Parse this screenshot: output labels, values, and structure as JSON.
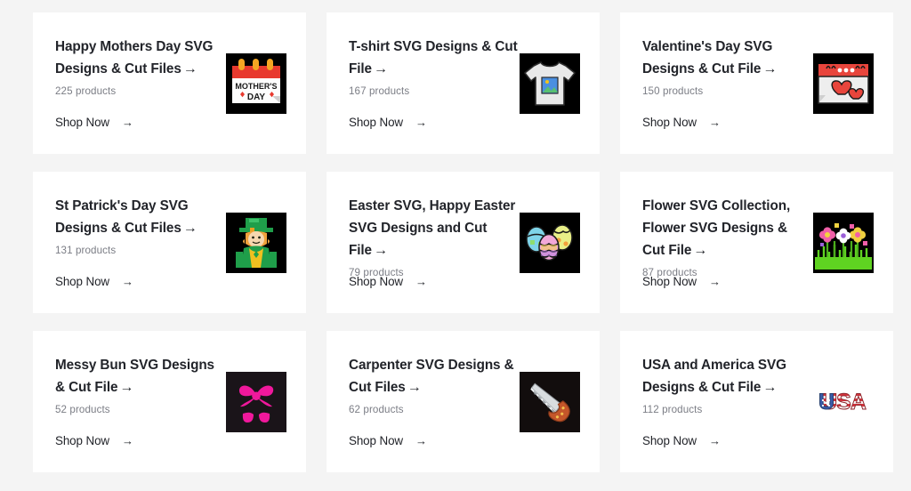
{
  "page": {
    "background_color": "#f4f4f4",
    "card_background_color": "#ffffff",
    "title_color": "#22242a",
    "count_color": "#7b7d85"
  },
  "common": {
    "shop_now_label": "Shop Now",
    "title_arrow": "→",
    "shop_arrow": "→"
  },
  "cards": [
    {
      "title": "Happy Mothers Day SVG Designs & Cut Files",
      "count": "225 products",
      "shop_now": "Shop Now",
      "thumb_name": "mothers-day-calendar-thumbnail",
      "thumb_bg": "#000000"
    },
    {
      "title": "T-shirt SVG Designs & Cut File",
      "count": "167 products",
      "shop_now": "Shop Now",
      "thumb_name": "tshirt-thumbnail",
      "thumb_bg": "#000000"
    },
    {
      "title": "Valentine's Day SVG Designs & Cut File",
      "count": "150 products",
      "shop_now": "Shop Now",
      "thumb_name": "valentines-calendar-hearts-thumbnail",
      "thumb_bg": "#000000"
    },
    {
      "title": "St Patrick's Day SVG Designs & Cut Files",
      "count": "131 products",
      "shop_now": "Shop Now",
      "thumb_name": "leprechaun-thumbnail",
      "thumb_bg": "#000000"
    },
    {
      "title": "Easter SVG, Happy Easter SVG Designs and Cut File",
      "count": "79 products",
      "shop_now": "Shop Now",
      "thumb_name": "easter-eggs-thumbnail",
      "thumb_bg": "#000000"
    },
    {
      "title": "Flower SVG Collection, Flower SVG Designs & Cut File",
      "count": "87 products",
      "shop_now": "Shop Now",
      "thumb_name": "flower-garden-thumbnail",
      "thumb_bg": "#000000"
    },
    {
      "title": "Messy Bun SVG Designs & Cut File",
      "count": "52 products",
      "shop_now": "Shop Now",
      "thumb_name": "messy-bun-bow-sunglasses-thumbnail",
      "thumb_bg": "#1a1419"
    },
    {
      "title": "Carpenter SVG Designs & Cut Files",
      "count": "62 products",
      "shop_now": "Shop Now",
      "thumb_name": "handsaw-thumbnail",
      "thumb_bg": "#120d0d"
    },
    {
      "title": "USA and America SVG Designs & Cut File",
      "count": "112 products",
      "shop_now": "Shop Now",
      "thumb_name": "usa-lettering-thumbnail",
      "thumb_bg": "#ffffff"
    }
  ]
}
